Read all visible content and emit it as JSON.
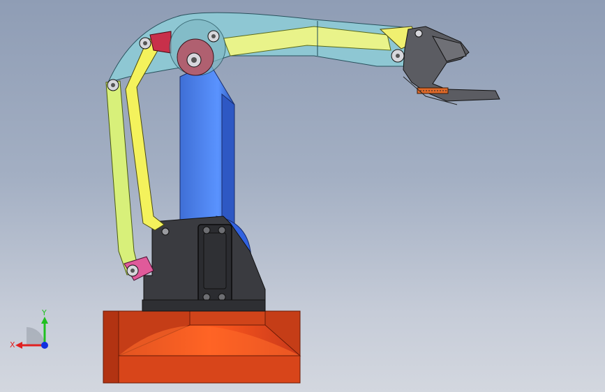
{
  "viewport": {
    "background_top": "#8f9db5",
    "background_bottom": "#d3d7df"
  },
  "triad": {
    "x_label": "X",
    "y_label": "Y",
    "x_color": "#e02020",
    "y_color": "#20c020",
    "z_color": "#1030e0"
  },
  "model": {
    "base_color": "#d9431a",
    "servo_body_color": "#3c3d42",
    "upper_arm_color": "#4f86f2",
    "forearm_color": "#8fd0dc",
    "linkage_yellow": "#f2f25a",
    "linkage_lime": "#d6f27a",
    "joint_accent_color": "#c8334f",
    "gripper_color": "#5a5b60"
  }
}
